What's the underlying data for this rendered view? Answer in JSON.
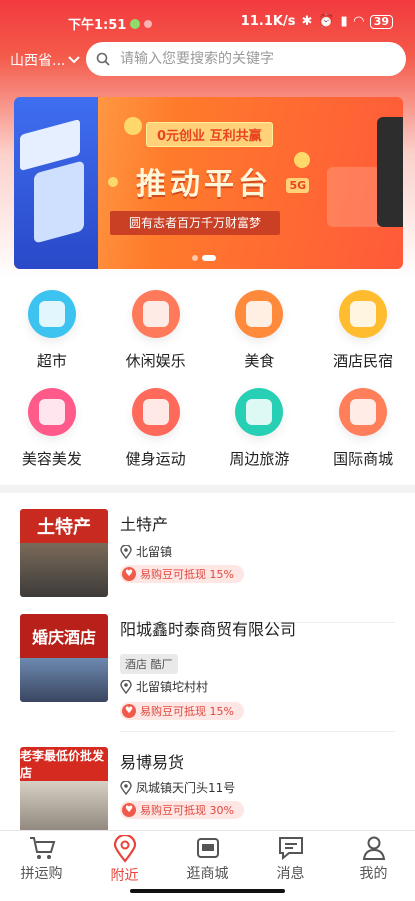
{
  "status": {
    "time": "下午1:51",
    "network": "11.1K/s",
    "battery": "39"
  },
  "header": {
    "region": "山西省...",
    "search_placeholder": "请输入您要搜索的关键字"
  },
  "banner": {
    "tag": "0元创业  互利共赢",
    "title": "推动平台",
    "badge": "5G",
    "subtitle": "圆有志者百万千万财富梦"
  },
  "categories": [
    {
      "label": "超市",
      "color": "#3cc3f0"
    },
    {
      "label": "休闲娱乐",
      "color": "#ff7a5a"
    },
    {
      "label": "美食",
      "color": "#ff8a3c"
    },
    {
      "label": "酒店民宿",
      "color": "#ffbc2e"
    },
    {
      "label": "美容美发",
      "color": "#ff5a8a"
    },
    {
      "label": "健身运动",
      "color": "#ff6a5a"
    },
    {
      "label": "周边旅游",
      "color": "#27cfb5"
    },
    {
      "label": "国际商城",
      "color": "#ff7f5a"
    }
  ],
  "stores": [
    {
      "name": "土特产",
      "sign": "土特产",
      "location": "北留镇",
      "tag": "",
      "promo": "易购豆可抵现 15%"
    },
    {
      "name": "阳城鑫时泰商贸有限公司",
      "sign": "婚庆酒店",
      "location": "北留镇坨村村",
      "tag": "酒店 酷厂",
      "promo": "易购豆可抵现 15%"
    },
    {
      "name": "易博易货",
      "sign": "老李最低价批发店",
      "location": "凤城镇天门头11号",
      "tag": "",
      "promo": "易购豆可抵现 30%"
    }
  ],
  "tabs": [
    {
      "label": "拼运购",
      "icon": "cart-icon"
    },
    {
      "label": "附近",
      "icon": "location-icon"
    },
    {
      "label": "逛商城",
      "icon": "mall-icon"
    },
    {
      "label": "消息",
      "icon": "message-icon"
    },
    {
      "label": "我的",
      "icon": "user-icon"
    }
  ],
  "colors": {
    "accent": "#e8443a",
    "header": "#f23a3e"
  }
}
